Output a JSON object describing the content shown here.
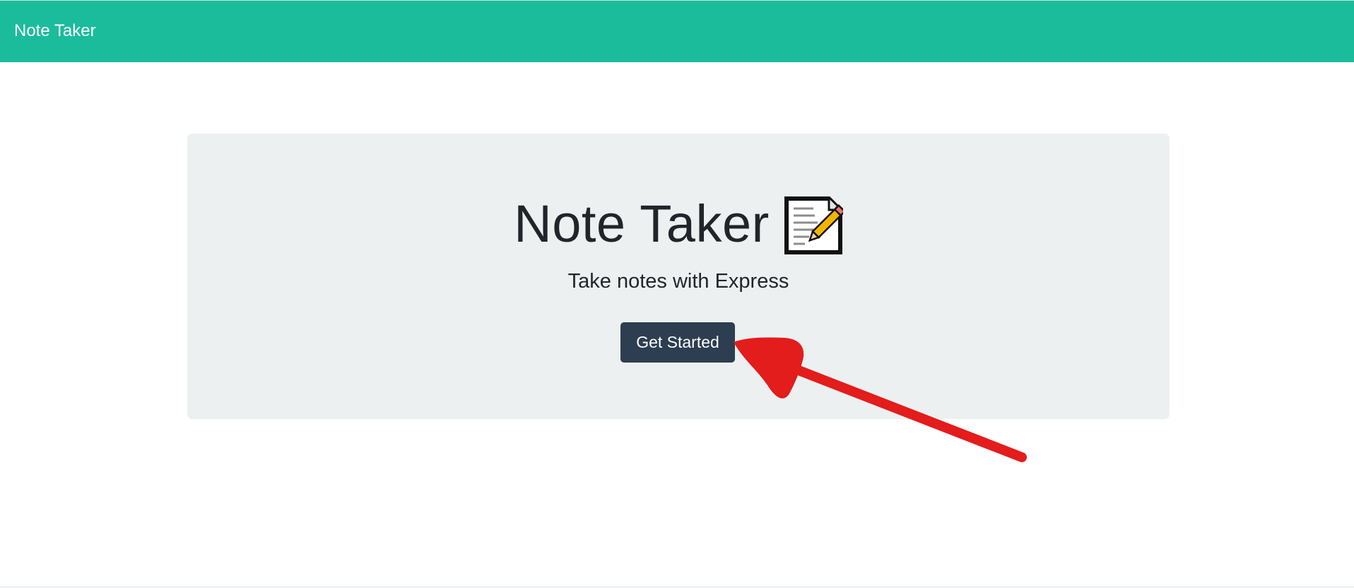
{
  "navbar": {
    "brand": "Note Taker"
  },
  "hero": {
    "title": "Note Taker",
    "title_icon": "notepad-pencil-icon",
    "lead": "Take notes with Express",
    "button_label": "Get Started"
  },
  "annotation": {
    "type": "arrow-pointing-to-get-started-button",
    "color": "#e31c1c"
  },
  "colors": {
    "accent": "#1abc9c",
    "button": "#2c3e50",
    "jumbotron": "#ecf0f1"
  }
}
